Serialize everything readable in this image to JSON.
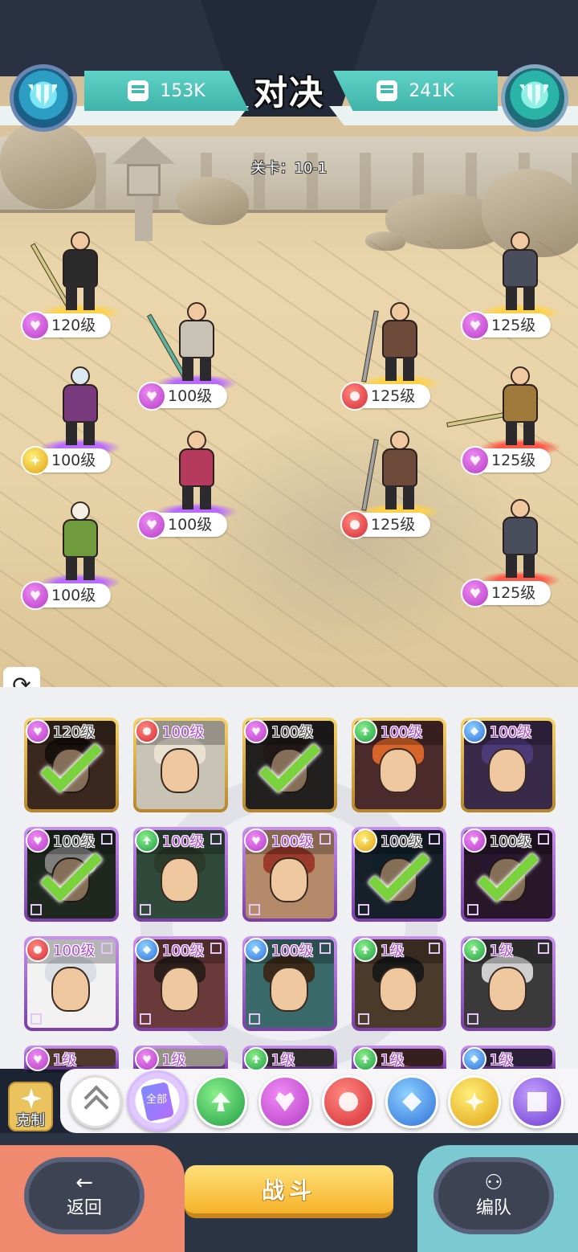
{
  "header": {
    "title": "对决",
    "left_power": "153K",
    "right_power": "241K",
    "stage": "关卡：10-1"
  },
  "field": {
    "allies": [
      {
        "level": "120级",
        "faction": "heart-purple"
      },
      {
        "level": "100级",
        "faction": "heart-purple"
      },
      {
        "level": "100级",
        "faction": "sun-gold"
      },
      {
        "level": "100级",
        "faction": "heart-purple"
      },
      {
        "level": "100级",
        "faction": "heart-purple"
      }
    ],
    "enemies": [
      {
        "level": "125级",
        "faction": "heart-purple"
      },
      {
        "level": "125级",
        "faction": "club-red"
      },
      {
        "level": "125级",
        "faction": "heart-purple"
      },
      {
        "level": "125级",
        "faction": "club-red"
      },
      {
        "level": "125级",
        "faction": "heart-purple"
      }
    ]
  },
  "roster": [
    {
      "level": "120级",
      "faction": "heart-purple",
      "selected": true
    },
    {
      "level": "100级",
      "faction": "club-red",
      "selected": false
    },
    {
      "level": "100级",
      "faction": "heart-purple",
      "selected": true
    },
    {
      "level": "100级",
      "faction": "spade-green",
      "selected": false
    },
    {
      "level": "100级",
      "faction": "diamond-blue",
      "selected": false
    },
    {
      "level": "100级",
      "faction": "heart-purple",
      "selected": true
    },
    {
      "level": "100级",
      "faction": "spade-green",
      "selected": false
    },
    {
      "level": "100级",
      "faction": "heart-purple",
      "selected": false
    },
    {
      "level": "100级",
      "faction": "sun-gold",
      "selected": true
    },
    {
      "level": "100级",
      "faction": "heart-purple",
      "selected": true
    },
    {
      "level": "100级",
      "faction": "club-red",
      "selected": false
    },
    {
      "level": "100级",
      "faction": "diamond-blue",
      "selected": false
    },
    {
      "level": "100级",
      "faction": "diamond-blue",
      "selected": false
    },
    {
      "level": "1级",
      "faction": "spade-green",
      "selected": false
    },
    {
      "level": "1级",
      "faction": "spade-green",
      "selected": false
    },
    {
      "level": "1级",
      "faction": "heart-purple",
      "selected": false
    },
    {
      "level": "1级",
      "faction": "heart-purple",
      "selected": false
    },
    {
      "level": "1级",
      "faction": "spade-green",
      "selected": false
    },
    {
      "level": "1级",
      "faction": "spade-green",
      "selected": false
    },
    {
      "level": "1级",
      "faction": "diamond-blue",
      "selected": false
    }
  ],
  "filters": {
    "counter_label": "克制",
    "all_label": "全部",
    "items": [
      "collapse",
      "all",
      "spade-green",
      "heart-purple",
      "club-red",
      "diamond-blue",
      "sun-gold",
      "moon-violet"
    ]
  },
  "actions": {
    "back_icon": "←",
    "back_label": "返回",
    "fight_label": "战斗",
    "team_icon": "👥",
    "team_label": "编队"
  }
}
